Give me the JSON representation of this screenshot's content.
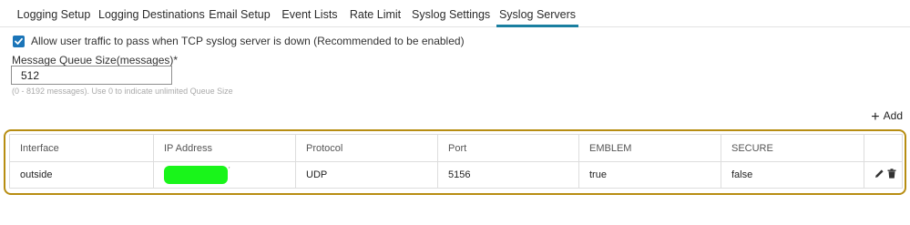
{
  "tabs": [
    {
      "label": "Logging Setup"
    },
    {
      "label": "Logging Destinations"
    },
    {
      "label": "Email Setup"
    },
    {
      "label": "Event Lists"
    },
    {
      "label": "Rate Limit"
    },
    {
      "label": "Syslog Settings"
    },
    {
      "label": "Syslog Servers",
      "active": true
    }
  ],
  "options": {
    "allow_traffic_label": "Allow user traffic to pass when TCP syslog server is down (Recommended to be enabled)",
    "allow_traffic_checked": true
  },
  "queue": {
    "label": "Message Queue Size(messages)*",
    "value": "512",
    "hint": "(0 - 8192 messages). Use 0 to indicate unlimited Queue Size"
  },
  "toolbar": {
    "add_label": "Add"
  },
  "table": {
    "columns": [
      "Interface",
      "IP Address",
      "Protocol",
      "Port",
      "EMBLEM",
      "SECURE"
    ],
    "rows": [
      {
        "interface": "outside",
        "ip_address": "",
        "protocol": "UDP",
        "port": "5156",
        "emblem": "true",
        "secure": "false"
      }
    ]
  },
  "colors": {
    "accent": "#1a7fa0",
    "checkbox": "#1b75b8",
    "table_highlight_border": "#b78d12",
    "redaction": "#19f51a"
  },
  "icons": [
    "check-icon",
    "plus-icon",
    "edit-pencil-icon",
    "trash-icon"
  ]
}
